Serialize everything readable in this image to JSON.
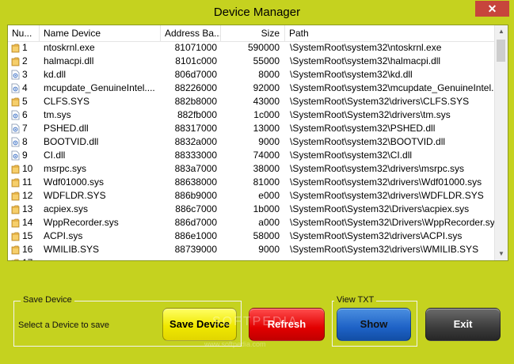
{
  "window": {
    "title": "Device Manager",
    "close_glyph": "✕"
  },
  "columns": [
    {
      "label": "Nu..."
    },
    {
      "label": "Name Device"
    },
    {
      "label": "Address Ba..."
    },
    {
      "label": "Size"
    },
    {
      "label": "Path"
    }
  ],
  "rows": [
    {
      "num": "1",
      "name": "ntoskrnl.exe",
      "addr": "81071000",
      "size": "590000",
      "path": "\\SystemRoot\\system32\\ntoskrnl.exe",
      "icon": "folder-icon"
    },
    {
      "num": "2",
      "name": "halmacpi.dll",
      "addr": "8101c000",
      "size": "55000",
      "path": "\\SystemRoot\\system32\\halmacpi.dll",
      "icon": "folder-icon"
    },
    {
      "num": "3",
      "name": "kd.dll",
      "addr": "806d7000",
      "size": "8000",
      "path": "\\SystemRoot\\system32\\kd.dll",
      "icon": "driver-file-icon"
    },
    {
      "num": "4",
      "name": "mcupdate_GenuineIntel....",
      "addr": "88226000",
      "size": "92000",
      "path": "\\SystemRoot\\system32\\mcupdate_GenuineIntel.dll",
      "icon": "driver-file-icon"
    },
    {
      "num": "5",
      "name": "CLFS.SYS",
      "addr": "882b8000",
      "size": "43000",
      "path": "\\SystemRoot\\System32\\drivers\\CLFS.SYS",
      "icon": "folder-icon"
    },
    {
      "num": "6",
      "name": "tm.sys",
      "addr": "882fb000",
      "size": "1c000",
      "path": "\\SystemRoot\\System32\\drivers\\tm.sys",
      "icon": "driver-file-icon"
    },
    {
      "num": "7",
      "name": "PSHED.dll",
      "addr": "88317000",
      "size": "13000",
      "path": "\\SystemRoot\\system32\\PSHED.dll",
      "icon": "driver-file-icon"
    },
    {
      "num": "8",
      "name": "BOOTVID.dll",
      "addr": "8832a000",
      "size": "9000",
      "path": "\\SystemRoot\\system32\\BOOTVID.dll",
      "icon": "driver-file-icon"
    },
    {
      "num": "9",
      "name": "CI.dll",
      "addr": "88333000",
      "size": "74000",
      "path": "\\SystemRoot\\system32\\CI.dll",
      "icon": "driver-file-icon"
    },
    {
      "num": "10",
      "name": "msrpc.sys",
      "addr": "883a7000",
      "size": "38000",
      "path": "\\SystemRoot\\system32\\drivers\\msrpc.sys",
      "icon": "folder-icon"
    },
    {
      "num": "11",
      "name": "Wdf01000.sys",
      "addr": "88638000",
      "size": "81000",
      "path": "\\SystemRoot\\system32\\drivers\\Wdf01000.sys",
      "icon": "folder-icon"
    },
    {
      "num": "12",
      "name": "WDFLDR.SYS",
      "addr": "886b9000",
      "size": "e000",
      "path": "\\SystemRoot\\system32\\drivers\\WDFLDR.SYS",
      "icon": "folder-icon"
    },
    {
      "num": "13",
      "name": "acpiex.sys",
      "addr": "886c7000",
      "size": "1b000",
      "path": "\\SystemRoot\\System32\\Drivers\\acpiex.sys",
      "icon": "folder-icon"
    },
    {
      "num": "14",
      "name": "WppRecorder.sys",
      "addr": "886d7000",
      "size": "a000",
      "path": "\\SystemRoot\\System32\\Drivers\\WppRecorder.sys",
      "icon": "folder-icon"
    },
    {
      "num": "15",
      "name": "ACPI.sys",
      "addr": "886e1000",
      "size": "58000",
      "path": "\\SystemRoot\\System32\\drivers\\ACPI.sys",
      "icon": "folder-icon"
    },
    {
      "num": "16",
      "name": "WMILIB.SYS",
      "addr": "88739000",
      "size": "9000",
      "path": "\\SystemRoot\\System32\\drivers\\WMILIB.SYS",
      "icon": "folder-icon"
    },
    {
      "num": "17",
      "name": "",
      "addr": "",
      "size": "",
      "path": "",
      "icon": "folder-icon"
    }
  ],
  "save_group": {
    "label": "Save Device",
    "hint": "Select a Device to save"
  },
  "view_group": {
    "label": "View TXT"
  },
  "buttons": {
    "save": "Save Device",
    "refresh": "Refresh",
    "show": "Show",
    "exit": "Exit"
  },
  "watermark": {
    "text": "SOFTPEDIA",
    "sub": "www.softpedia.com"
  },
  "colors": {
    "background": "#c5d21f",
    "close": "#c7453c",
    "save": "#f0e800",
    "refresh": "#e20000",
    "show": "#1e62c6",
    "exit": "#3c3c3c"
  }
}
